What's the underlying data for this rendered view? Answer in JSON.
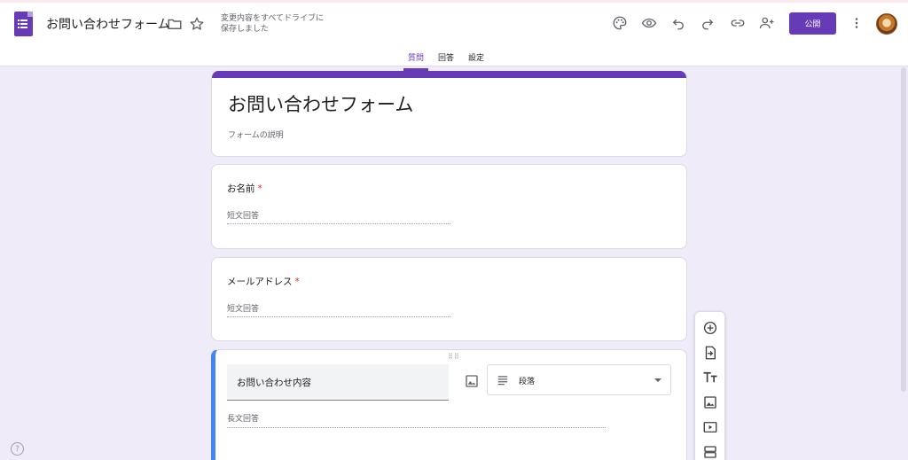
{
  "header": {
    "doc_title": "お問い合わせフォーム",
    "save_status": "変更内容をすべてドライブに保存しました",
    "publish_label": "公開",
    "icons": [
      "folder-icon",
      "star-icon",
      "palette-icon",
      "preview-icon",
      "undo-icon",
      "redo-icon",
      "link-icon",
      "add-collaborator-icon",
      "more-vert-icon"
    ]
  },
  "tabs": [
    {
      "label": "質問",
      "active": true
    },
    {
      "label": "回答",
      "active": false
    },
    {
      "label": "設定",
      "active": false
    }
  ],
  "form": {
    "title": "お問い合わせフォーム",
    "description_placeholder": "フォームの説明"
  },
  "questions": [
    {
      "label": "お名前",
      "required": true,
      "answer_hint": "短文回答"
    },
    {
      "label": "メールアドレス",
      "required": true,
      "answer_hint": "短文回答"
    },
    {
      "label": "お問い合わせ内容",
      "type": "段落",
      "answer_hint": "長文回答"
    }
  ],
  "required_mark": "*",
  "colors": {
    "accent": "#673ab7",
    "background": "#f0ebf8",
    "active_question_border": "#4285f4",
    "required": "#d93025"
  },
  "side_toolbar": [
    "add-question-icon",
    "import-questions-icon",
    "add-title-icon",
    "add-image-icon",
    "add-video-icon",
    "add-section-icon"
  ],
  "help_label": "?"
}
